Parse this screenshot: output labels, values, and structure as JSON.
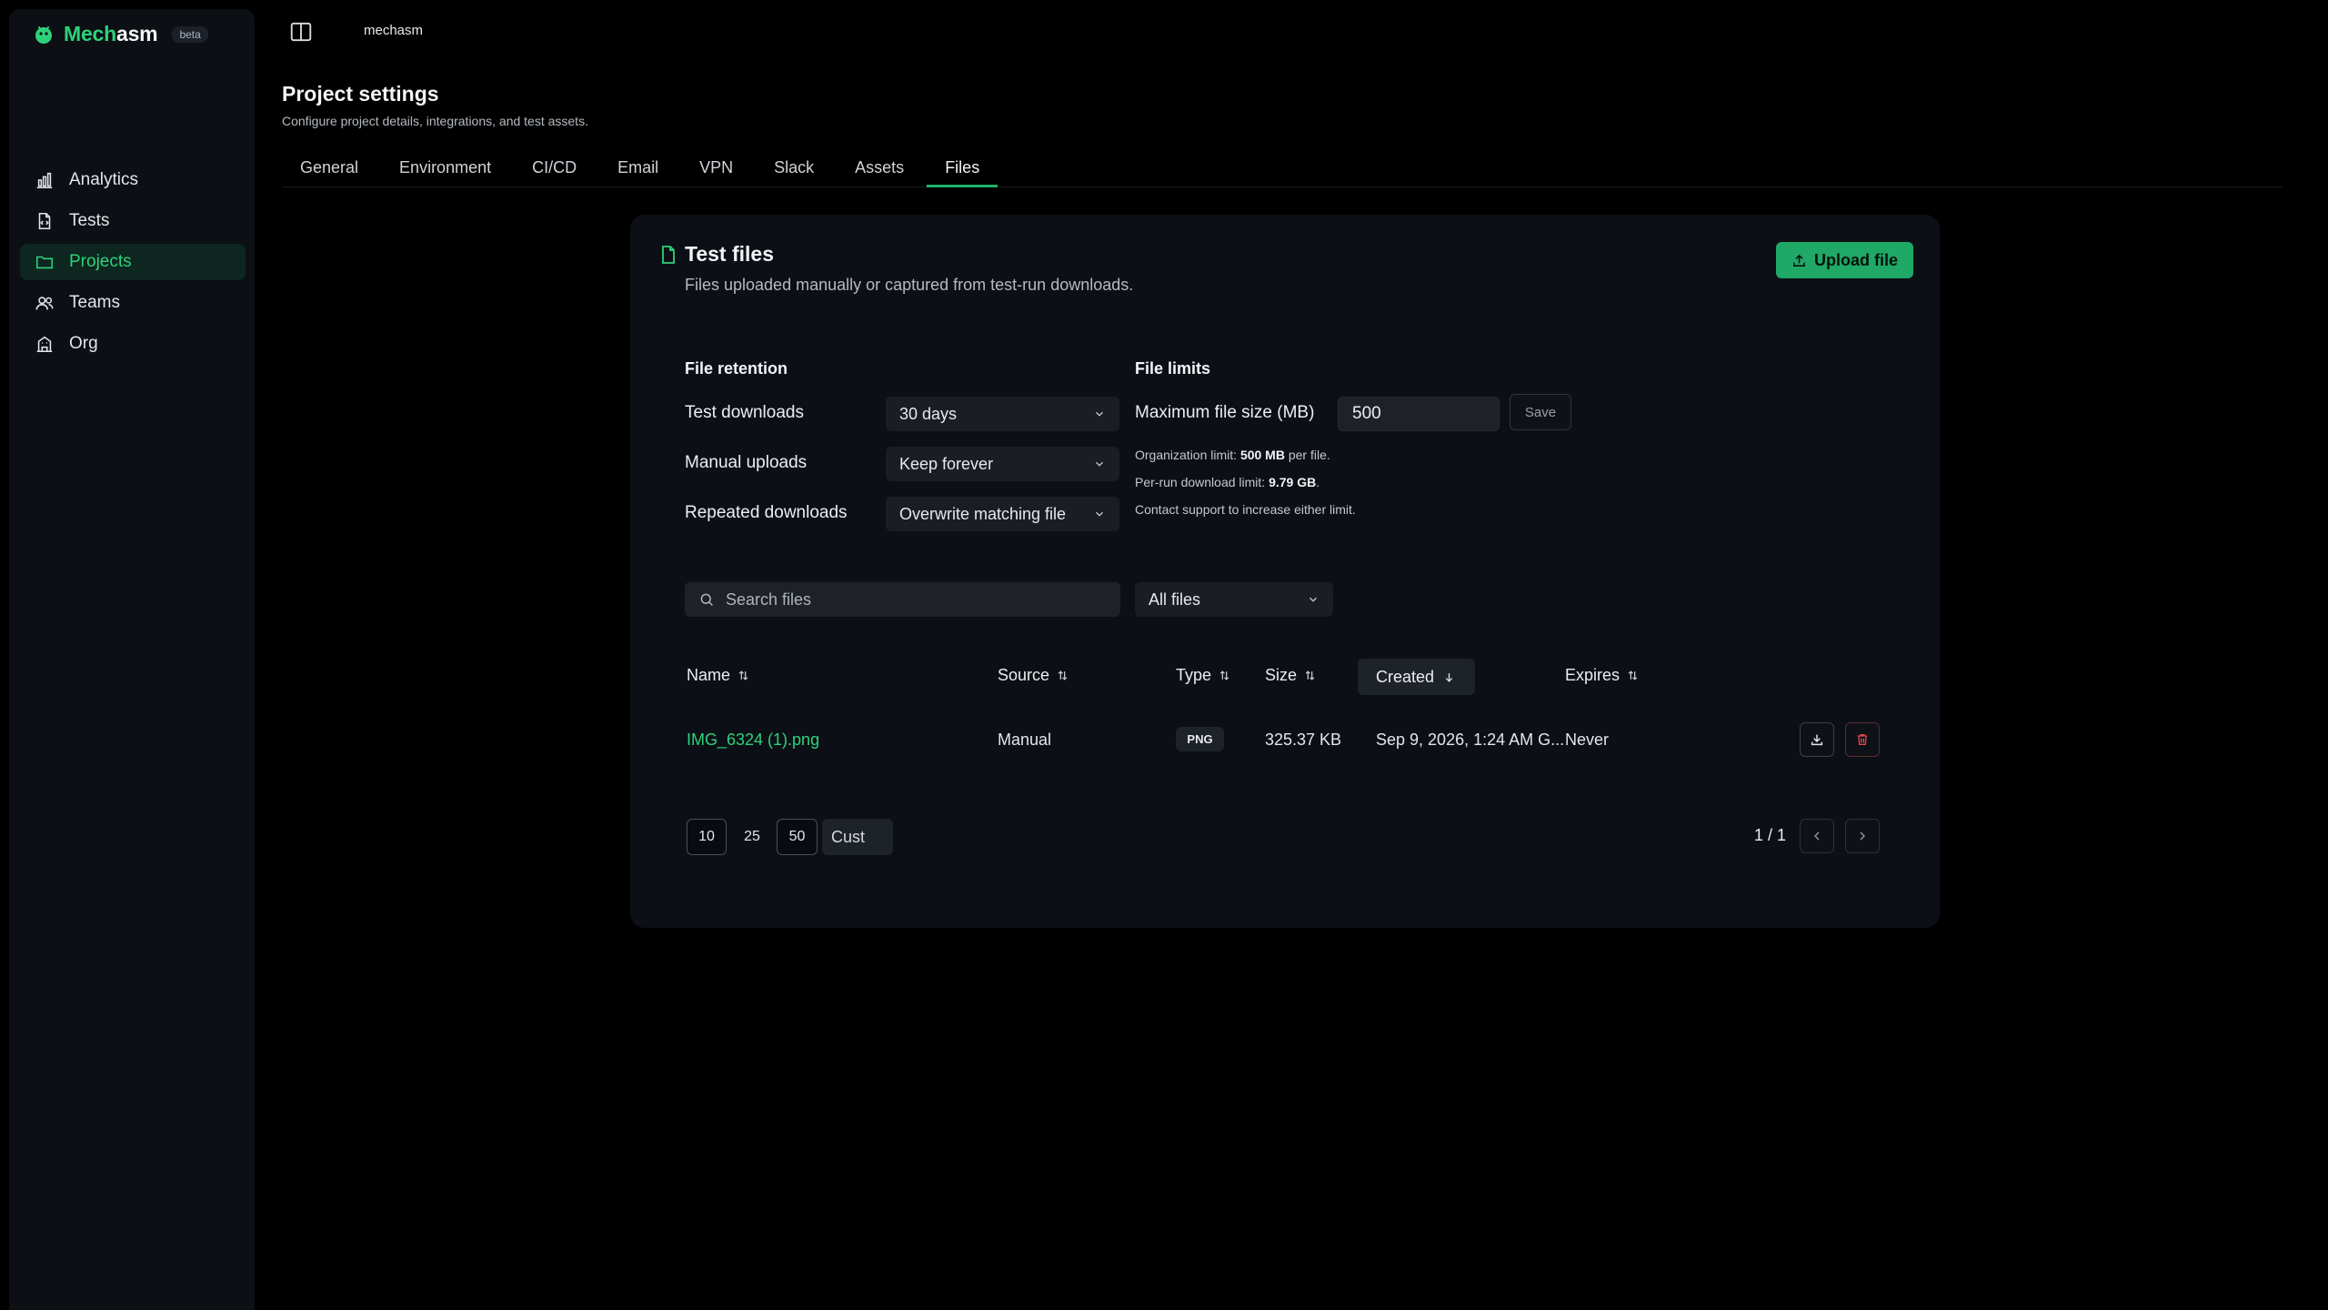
{
  "app": {
    "name_part1": "Mech",
    "name_part2": "asm",
    "badge": "beta"
  },
  "sidebar": {
    "items": [
      {
        "label": "Analytics",
        "icon": "bar-chart-icon"
      },
      {
        "label": "Tests",
        "icon": "file-code-icon"
      },
      {
        "label": "Projects",
        "icon": "folder-icon",
        "active": true
      },
      {
        "label": "Teams",
        "icon": "users-icon"
      },
      {
        "label": "Org",
        "icon": "building-icon"
      }
    ]
  },
  "topbar": {
    "breadcrumb": "mechasm"
  },
  "page": {
    "title": "Project settings",
    "subtitle": "Configure project details, integrations, and test assets."
  },
  "tabs": [
    "General",
    "Environment",
    "CI/CD",
    "Email",
    "VPN",
    "Slack",
    "Assets",
    "Files"
  ],
  "active_tab": "Files",
  "card": {
    "title": "Test files",
    "subtitle": "Files uploaded manually or captured from test-run downloads.",
    "upload_label": "Upload file"
  },
  "retention": {
    "title": "File retention",
    "rows": [
      {
        "label": "Test downloads",
        "value": "30 days"
      },
      {
        "label": "Manual uploads",
        "value": "Keep forever"
      },
      {
        "label": "Repeated downloads",
        "value": "Overwrite matching file"
      }
    ]
  },
  "limits": {
    "title": "File limits",
    "max_label": "Maximum file size (MB)",
    "max_value": "500",
    "save_label": "Save",
    "org_prefix": "Organization limit: ",
    "org_value": "500 MB",
    "org_suffix": " per file.",
    "run_prefix": "Per-run download limit: ",
    "run_value": "9.79 GB",
    "run_suffix": ".",
    "contact": "Contact support to increase either limit."
  },
  "search": {
    "placeholder": "Search files"
  },
  "filter": {
    "value": "All files"
  },
  "table": {
    "columns": {
      "name": "Name",
      "source": "Source",
      "type": "Type",
      "size": "Size",
      "created": "Created",
      "expires": "Expires"
    },
    "rows": [
      {
        "name": "IMG_6324 (1).png",
        "source": "Manual",
        "type": "PNG",
        "size": "325.37 KB",
        "created": "Sep 9, 2026, 1:24 AM G...",
        "expires": "Never"
      }
    ]
  },
  "pagination": {
    "sizes": [
      "10",
      "25",
      "50"
    ],
    "custom": "Cust",
    "count": "1 / 1"
  },
  "colors": {
    "accent": "#2dd27a",
    "button": "#1fa866",
    "background": "#000000",
    "panel": "#0c1016"
  }
}
